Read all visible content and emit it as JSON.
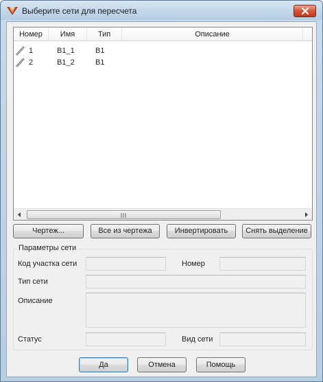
{
  "window": {
    "title": "Выберите сети для пересчета"
  },
  "list": {
    "columns": [
      "Номер",
      "Имя",
      "Тип",
      "Описание"
    ],
    "rows": [
      {
        "number": "1",
        "name": "B1_1",
        "type": "B1",
        "description": ""
      },
      {
        "number": "2",
        "name": "B1_2",
        "type": "B1",
        "description": ""
      }
    ]
  },
  "actions": {
    "drawing": "Чертеж...",
    "all_from_drawing": "Все из чертежа",
    "invert": "Инвертировать",
    "clear_selection": "Снять выделение"
  },
  "params": {
    "group_title": "Параметры сети",
    "section_code_label": "Код участка сети",
    "section_code_value": "",
    "number_label": "Номер",
    "number_value": "",
    "network_type_label": "Тип сети",
    "network_type_value": "",
    "description_label": "Описание",
    "description_value": "",
    "status_label": "Статус",
    "status_value": "",
    "network_kind_label": "Вид сети",
    "network_kind_value": ""
  },
  "footer": {
    "ok": "Да",
    "cancel": "Отмена",
    "help": "Помощь"
  },
  "icons": {
    "app": "app-logo-icon",
    "close": "close-icon",
    "row": "pipe-icon"
  }
}
